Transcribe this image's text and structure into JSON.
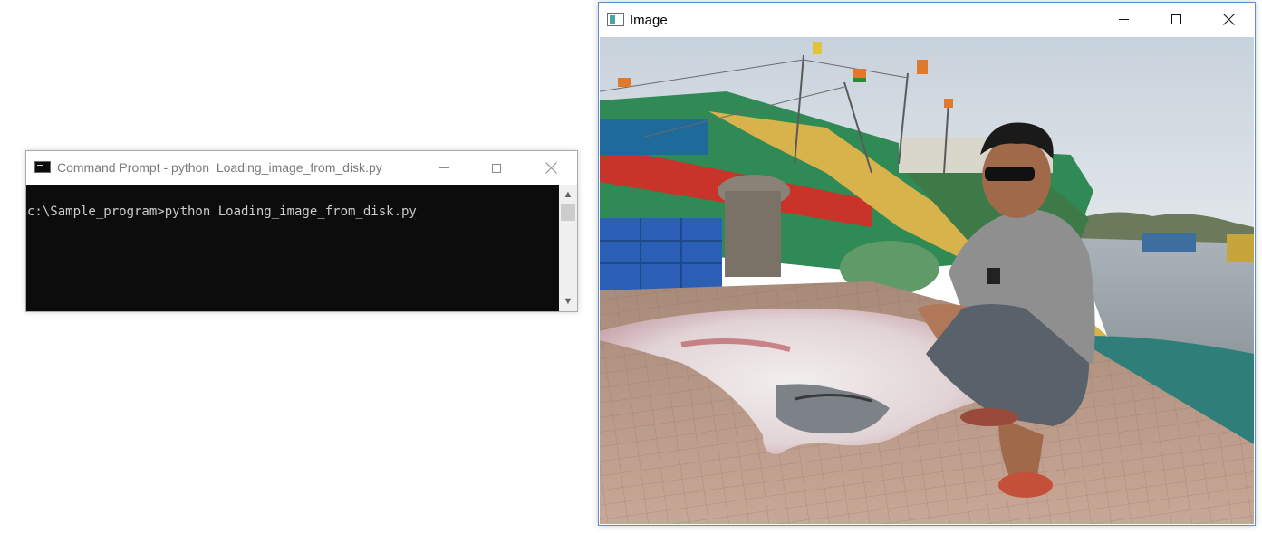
{
  "desktop": {
    "background": "#ffffff"
  },
  "cmd_window": {
    "title": "Command Prompt - python  Loading_image_from_disk.py",
    "icon": "console-app-icon",
    "controls": {
      "minimize": "minimize-icon",
      "maximize": "maximize-icon",
      "close": "close-icon"
    },
    "console": {
      "lines": [
        "c:\\Sample_program>python Loading_image_from_disk.py"
      ],
      "background": "#0c0c0c",
      "text_color": "#cccccc"
    },
    "scrollbar": {
      "up_arrow": "▲",
      "down_arrow": "▼"
    }
  },
  "image_window": {
    "title": "Image",
    "icon": "image-app-icon",
    "controls": {
      "minimize": "minimize-icon",
      "maximize": "maximize-icon",
      "close": "close-icon"
    },
    "border_color": "#5a8fd0",
    "content": "photo-of-person-crouching-beside-manta-ray-on-fishing-dock"
  }
}
